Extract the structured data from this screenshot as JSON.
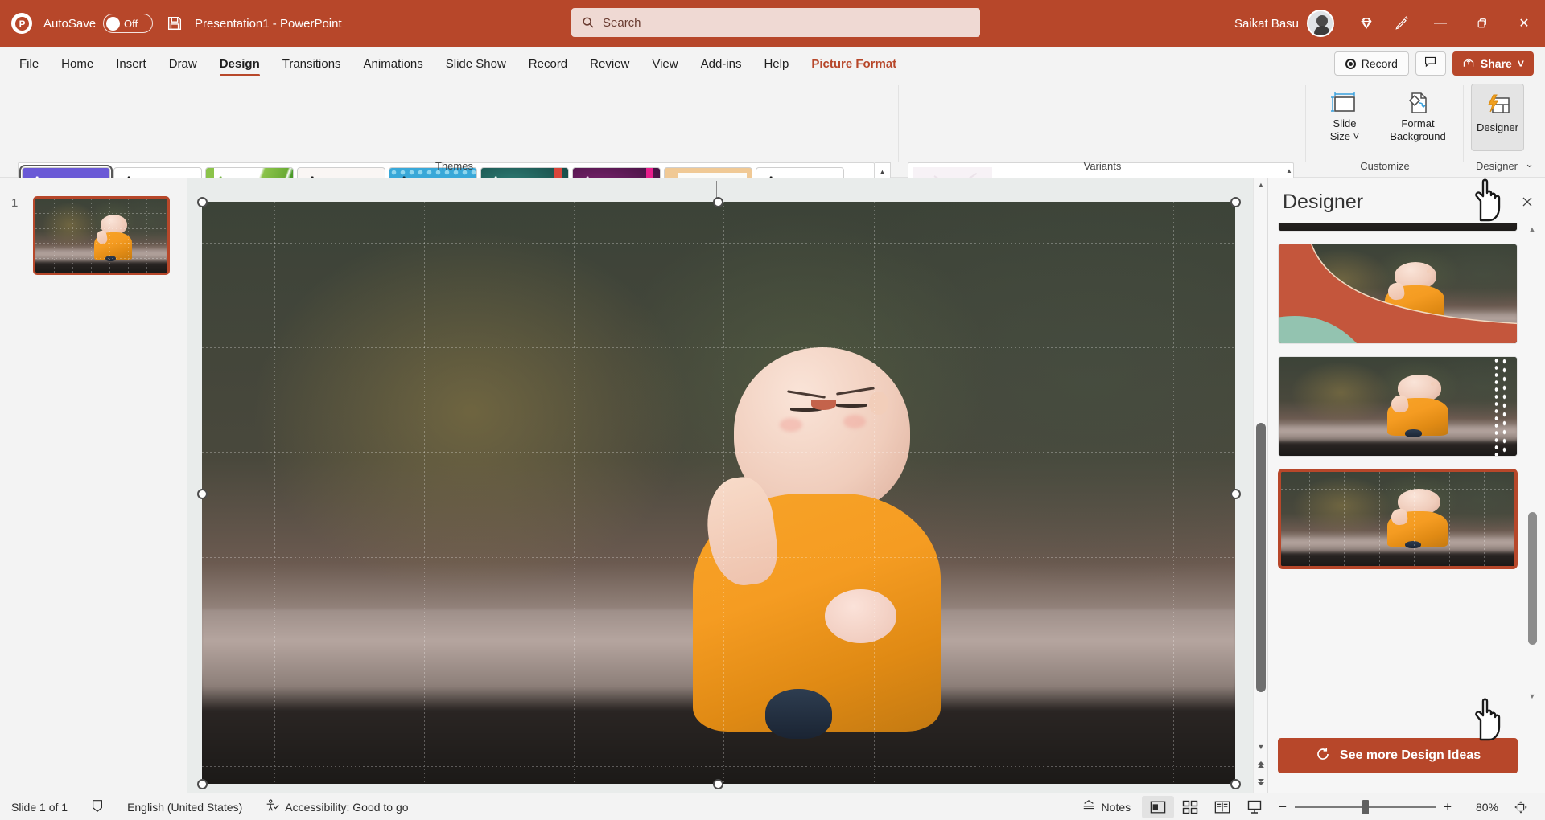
{
  "titlebar": {
    "app_logo": "powerpoint-logo",
    "autosave_label": "AutoSave",
    "autosave_state": "Off",
    "save_icon": "save-icon",
    "document_title": "Presentation1  -  PowerPoint",
    "search_placeholder": "Search",
    "search_icon": "search-icon",
    "user_name": "Saikat Basu",
    "diamond_icon": "diamond-icon",
    "pen_icon": "pen-feedback-icon",
    "minimize": "—",
    "restore": "❐",
    "close": "✕"
  },
  "tabs": [
    {
      "label": "File",
      "active": false,
      "contextual": false
    },
    {
      "label": "Home",
      "active": false,
      "contextual": false
    },
    {
      "label": "Insert",
      "active": false,
      "contextual": false
    },
    {
      "label": "Draw",
      "active": false,
      "contextual": false
    },
    {
      "label": "Design",
      "active": true,
      "contextual": false
    },
    {
      "label": "Transitions",
      "active": false,
      "contextual": false
    },
    {
      "label": "Animations",
      "active": false,
      "contextual": false
    },
    {
      "label": "Slide Show",
      "active": false,
      "contextual": false
    },
    {
      "label": "Record",
      "active": false,
      "contextual": false
    },
    {
      "label": "Review",
      "active": false,
      "contextual": false
    },
    {
      "label": "View",
      "active": false,
      "contextual": false
    },
    {
      "label": "Add-ins",
      "active": false,
      "contextual": false
    },
    {
      "label": "Help",
      "active": false,
      "contextual": false
    },
    {
      "label": "Picture Format",
      "active": false,
      "contextual": true
    }
  ],
  "tabstrip_right": {
    "record_label": "Record",
    "comment_icon": "comment-icon",
    "share_label": "Share",
    "share_caret": "˅"
  },
  "ribbon": {
    "groups": {
      "themes": "Themes",
      "variants": "Variants",
      "customize": "Customize",
      "designer": "Designer"
    },
    "themes": [
      {
        "name": "office-theme",
        "aa": "Aa",
        "bg": "#6a59d6",
        "aa_color": "#ffffff",
        "selected": true,
        "swatches": [
          "#f08a7e",
          "#b9b9b9",
          "#c9c9c9",
          "#d0d0d0",
          "#3fbfa0"
        ]
      },
      {
        "name": "blank-theme",
        "aa": "Aa",
        "bg": "#ffffff",
        "aa_color": "#1a1a1a",
        "selected": false,
        "swatches": [
          "#2f6fb5",
          "#e8701a",
          "#9e9e9e",
          "#f0b323",
          "#4a9fd8",
          "#63a91f"
        ]
      },
      {
        "name": "berlin-theme",
        "aa": "Aa",
        "bg": "#ffffff",
        "aa_color": "#7ab648",
        "selected": false,
        "swatches": [
          "#8bc34a",
          "#4a9a28",
          "#f0b323",
          "#e8701a",
          "#d93025",
          "#8d7b60"
        ]
      },
      {
        "name": "wisp-theme",
        "aa": "Aa",
        "bg": "#f7f2f0",
        "aa_color": "#1a1a1a",
        "selected": false,
        "swatches": [
          "#c2185b",
          "#e91e8c",
          "#b14fd8",
          "#6b63c9",
          "#3f6fd1",
          "#5b9bd5"
        ]
      },
      {
        "name": "facet-theme",
        "aa": "Aa",
        "bg": "#39a8d8",
        "aa_color": "#15303f",
        "selected": false,
        "swatches": [
          "#2f9fd8",
          "#2f7fc4",
          "#2fc4c4",
          "#3aa98f",
          "#2e7d55",
          "#5a8f74"
        ]
      },
      {
        "name": "quotable-theme",
        "aa": "Aa",
        "bg": "#1f5e5a",
        "aa_color": "#eaf5f2",
        "selected": false,
        "swatches": [
          "#d9453a",
          "#e8701a",
          "#f0a623",
          "#f0d423",
          "#8fc4b0",
          "#8fb0c4",
          "#b08fd8"
        ]
      },
      {
        "name": "dividend-theme",
        "aa": "Aa",
        "bg": "#5c1a5c",
        "aa_color": "#f2d9f2",
        "selected": false,
        "swatches": [
          "#e91e8c",
          "#e8568c",
          "#e8703a",
          "#f0a623",
          "#a060f0",
          "#e040d0"
        ]
      },
      {
        "name": "frame-theme",
        "aa": "Aa",
        "bg": "#f0c995",
        "aa_color": "#2b2b2b",
        "selected": false,
        "swatches": [
          "#8bbf3f",
          "#3aa98f",
          "#3a7fd8",
          "#c43a2f",
          "#e8832a",
          "#d9b03a"
        ]
      },
      {
        "name": "badge-theme",
        "aa": "Aa",
        "bg": "#ffffff",
        "aa_color": "#1a1a1a",
        "selected": false,
        "swatches": [
          "#e8832a",
          "#c4522a",
          "#8a6a4a",
          "#a3996f",
          "#ccc49a",
          "#9aa89a"
        ]
      }
    ],
    "gallery_arrows": {
      "up": "▲",
      "down": "▼",
      "more": "⌄"
    },
    "variants_more": {
      "up": "▲",
      "down": "▼",
      "more": "⌄"
    },
    "customize": {
      "slide_size_label_line1": "Slide",
      "slide_size_label_line2": "Size",
      "slide_size_caret": "˅",
      "slide_size_icon": "slide-size-icon",
      "format_background_line1": "Format",
      "format_background_line2": "Background",
      "format_background_icon": "format-background-icon"
    },
    "designer_button": {
      "label": "Designer",
      "icon": "designer-lightning-icon"
    },
    "collapse_caret": "⌄"
  },
  "thumbnail_pane": {
    "slide_number": "1",
    "slide_name": "slide-thumbnail-1"
  },
  "designer_pane": {
    "title": "Designer",
    "close_icon": "close-icon",
    "see_more_label": "See more Design Ideas",
    "refresh_icon": "refresh-icon",
    "ideas": [
      {
        "name": "design-idea-1",
        "style": "photo-partial-top",
        "selected": false
      },
      {
        "name": "design-idea-2",
        "style": "curved-coral-teal",
        "selected": false
      },
      {
        "name": "design-idea-3",
        "style": "dotted-divider",
        "selected": false
      },
      {
        "name": "design-idea-4",
        "style": "full-bleed-grid",
        "selected": true
      }
    ],
    "scroll": {
      "up": "▲",
      "down": "▼"
    }
  },
  "canvas": {
    "slide_image_alt": "smiling-baby-monk-figurine",
    "selection_handles": 8
  },
  "statusbar": {
    "slide_status": "Slide 1 of 1",
    "book_icon": "spell-check-icon",
    "language": "English (United States)",
    "accessibility_icon": "accessibility-icon",
    "accessibility": "Accessibility: Good to go",
    "notes_label": "Notes",
    "notes_icon": "notes-caret-icon",
    "views": [
      {
        "name": "normal-view-button",
        "icon": "normal-view-icon",
        "active": true
      },
      {
        "name": "slide-sorter-view-button",
        "icon": "slide-sorter-icon",
        "active": false
      },
      {
        "name": "reading-view-button",
        "icon": "reading-view-icon",
        "active": false
      },
      {
        "name": "slide-show-button",
        "icon": "slide-show-icon",
        "active": false
      }
    ],
    "zoom_out": "−",
    "zoom_in": "+",
    "zoom_level": "80%",
    "fit_icon": "fit-to-window-icon"
  },
  "colors": {
    "brand": "#b7472a",
    "ribbon_bg": "#f3f3f3",
    "canvas_bg": "#e9eceb",
    "selection": "#b7472a"
  },
  "vscroll": {
    "up": "▲",
    "down": "▼",
    "prev": "⬆",
    "next": "⬇"
  }
}
